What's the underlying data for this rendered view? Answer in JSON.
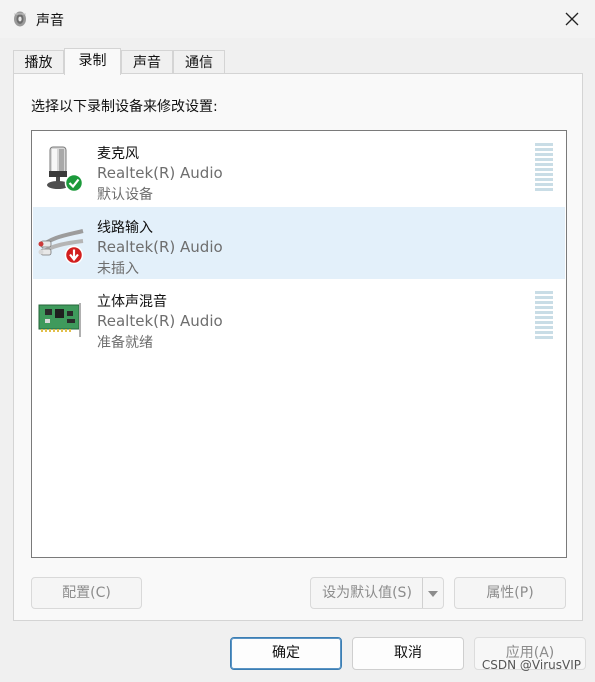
{
  "window": {
    "title": "声音"
  },
  "tabs": [
    {
      "label": "播放",
      "active": false
    },
    {
      "label": "录制",
      "active": true
    },
    {
      "label": "声音",
      "active": false
    },
    {
      "label": "通信",
      "active": false
    }
  ],
  "panel": {
    "instruction": "选择以下录制设备来修改设置:"
  },
  "devices": [
    {
      "name": "麦克风",
      "driver": "Realtek(R) Audio",
      "status": "默认设备",
      "icon": "microphone-icon",
      "badge": "default-check-icon",
      "selected": false
    },
    {
      "name": "线路输入",
      "driver": "Realtek(R) Audio",
      "status": "未插入",
      "icon": "line-in-cable-icon",
      "badge": "unplugged-arrow-icon",
      "selected": true
    },
    {
      "name": "立体声混音",
      "driver": "Realtek(R) Audio",
      "status": "准备就绪",
      "icon": "sound-card-icon",
      "badge": "",
      "selected": false
    }
  ],
  "buttons": {
    "configure": "配置(C)",
    "set_default": "设为默认值(S)",
    "properties": "属性(P)"
  },
  "footer": {
    "ok": "确定",
    "cancel": "取消",
    "apply": "应用(A)"
  },
  "watermark": "CSDN @VirusVIP",
  "colors": {
    "selection": "#e3f0fa",
    "check_badge": "#1c9a3b",
    "unplug_badge": "#d21e1e",
    "level_meter": "#c9dde6"
  }
}
